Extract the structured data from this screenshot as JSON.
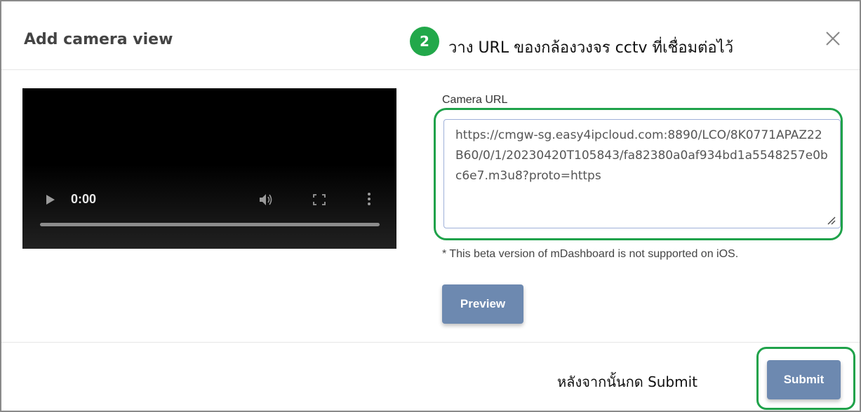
{
  "dialog": {
    "title": "Add camera view"
  },
  "annotations": {
    "step_number": "2",
    "step_text": "วาง URL ของกล้องวงจร cctv ที่เชื่อมต่อไว้",
    "submit_hint": "หลังจากนั้นกด Submit",
    "highlight_color": "#1fa24a"
  },
  "video": {
    "time": "0:00",
    "progress": 0
  },
  "form": {
    "camera_url_label": "Camera URL",
    "camera_url_value": "https://cmgw-sg.easy4ipcloud.com:8890/LCO/8K0771APAZ22B60/0/1/20230420T105843/fa82380a0af934bd1a5548257e0bc6e7.m3u8?proto=https",
    "note": "* This beta version of mDashboard is not supported on iOS.",
    "preview_label": "Preview"
  },
  "footer": {
    "submit_label": "Submit"
  },
  "colors": {
    "button": "#6d89b0",
    "badge": "#22a84a"
  },
  "icons": [
    "close-icon",
    "play-icon",
    "volume-icon",
    "fullscreen-icon",
    "more-vert-icon",
    "resize-handle-icon"
  ]
}
